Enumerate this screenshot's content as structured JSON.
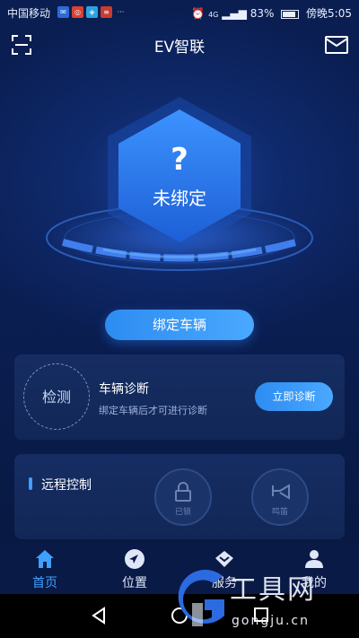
{
  "status_bar": {
    "carrier": "中国移动",
    "network": "4G",
    "battery": "83%",
    "time": "傍晚5:05",
    "notification_icons": [
      "mail-icon",
      "ring-icon",
      "map-icon",
      "news-icon",
      "more-icon"
    ]
  },
  "header": {
    "title": "EV智联",
    "left_icon": "scan-icon",
    "right_icon": "message-icon"
  },
  "hero": {
    "symbol": "?",
    "status": "未绑定"
  },
  "bind_button": "绑定车辆",
  "diagnosis_card": {
    "ring_label": "检测",
    "title": "车辆诊断",
    "subtitle": "绑定车辆后才可进行诊断",
    "button": "立即诊断"
  },
  "remote_card": {
    "title": "远程控制",
    "controls": [
      {
        "label": "已锁",
        "icon": "lock-icon"
      },
      {
        "label": "鸣笛",
        "icon": "horn-icon"
      }
    ]
  },
  "tabs": [
    {
      "label": "首页",
      "icon": "home-icon",
      "active": true
    },
    {
      "label": "位置",
      "icon": "location-icon",
      "active": false
    },
    {
      "label": "服务",
      "icon": "service-icon",
      "active": false
    },
    {
      "label": "我的",
      "icon": "profile-icon",
      "active": false
    }
  ],
  "system_nav": [
    "back-icon",
    "home-circle-icon",
    "recent-icon"
  ],
  "watermark": {
    "text": "工具网",
    "url": "gongju.cn"
  },
  "colors": {
    "accent": "#3fa0ff",
    "background": "#07173a",
    "card": "#142b5e"
  }
}
